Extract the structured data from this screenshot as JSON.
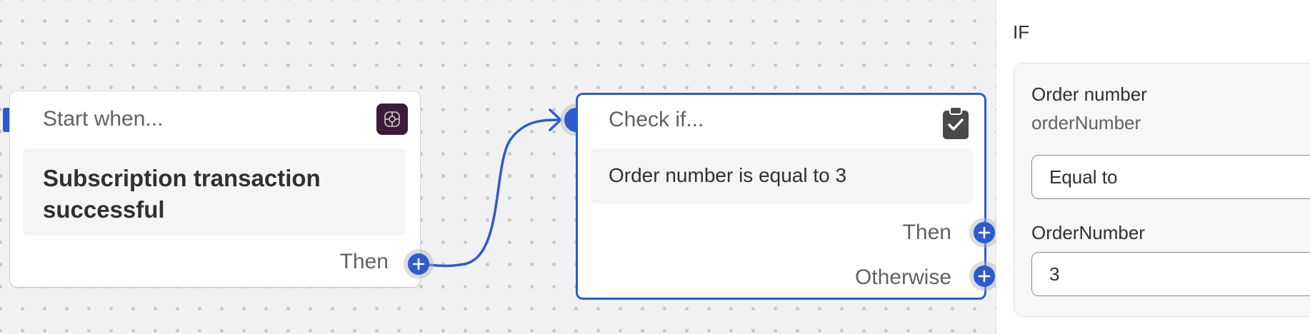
{
  "colors": {
    "accent": "#2c5bd0",
    "canvas_bg": "#f1f1f1",
    "app_icon_bg": "#3a1d35"
  },
  "start_node": {
    "title": "Start when...",
    "app_icon": "flow-app-icon",
    "trigger": "Subscription transaction successful",
    "then_label": "Then"
  },
  "check_node": {
    "title": "Check if...",
    "icon": "clipboard-check-icon",
    "condition": "Order number is equal to 3",
    "then_label": "Then",
    "otherwise_label": "Otherwise"
  },
  "panel": {
    "heading": "IF",
    "field_label": "Order number",
    "field_variable": "orderNumber",
    "operator_value": "Equal to",
    "value_label": "OrderNumber",
    "value": "3"
  }
}
